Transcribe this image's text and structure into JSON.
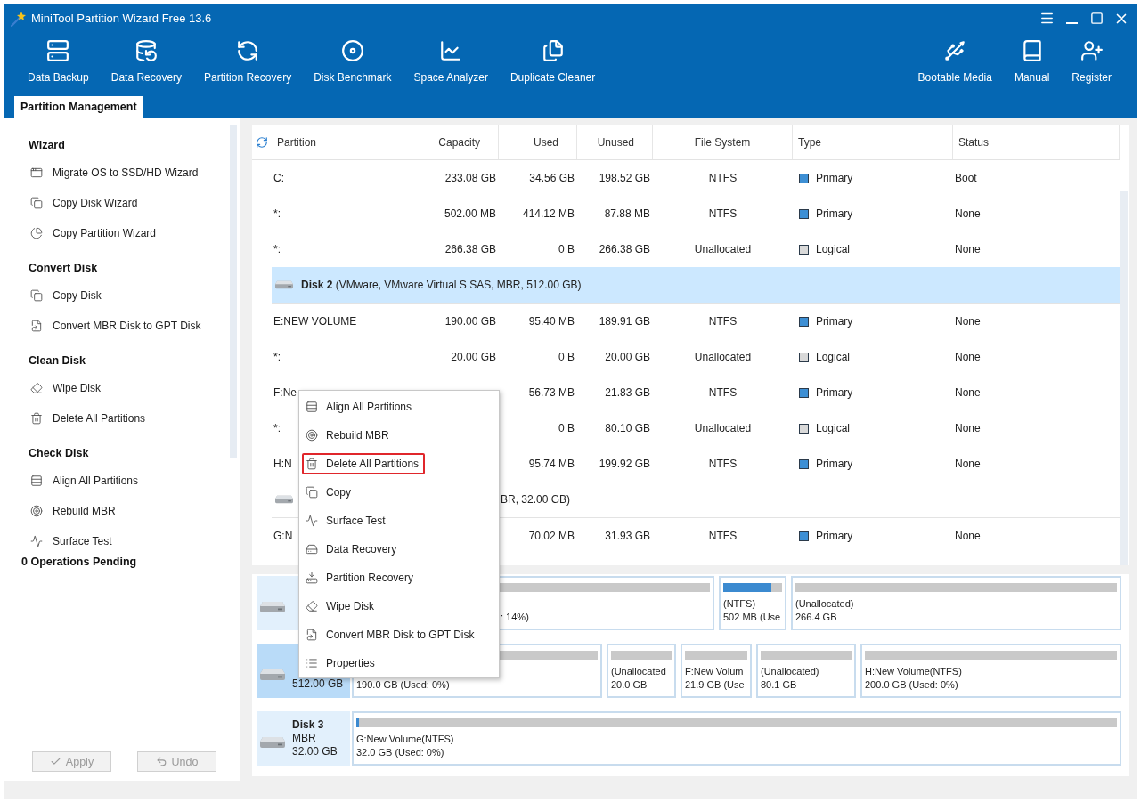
{
  "window": {
    "title": "MiniTool Partition Wizard Free 13.6"
  },
  "toolbar": {
    "left": [
      {
        "label": "Data Backup"
      },
      {
        "label": "Data Recovery"
      },
      {
        "label": "Partition Recovery"
      },
      {
        "label": "Disk Benchmark"
      },
      {
        "label": "Space Analyzer"
      },
      {
        "label": "Duplicate Cleaner"
      }
    ],
    "right": [
      {
        "label": "Bootable Media"
      },
      {
        "label": "Manual"
      },
      {
        "label": "Register"
      }
    ]
  },
  "tabs": [
    {
      "label": "Partition Management",
      "selected": true
    }
  ],
  "sidebar": {
    "sections": [
      {
        "heading": "Wizard",
        "items": [
          {
            "label": "Migrate OS to SSD/HD Wizard"
          },
          {
            "label": "Copy Disk Wizard"
          },
          {
            "label": "Copy Partition Wizard"
          }
        ]
      },
      {
        "heading": "Convert Disk",
        "items": [
          {
            "label": "Copy Disk"
          },
          {
            "label": "Convert MBR Disk to GPT Disk"
          }
        ]
      },
      {
        "heading": "Clean Disk",
        "items": [
          {
            "label": "Wipe Disk"
          },
          {
            "label": "Delete All Partitions"
          }
        ]
      },
      {
        "heading": "Check Disk",
        "items": [
          {
            "label": "Align All Partitions"
          },
          {
            "label": "Rebuild MBR"
          },
          {
            "label": "Surface Test"
          }
        ]
      }
    ],
    "pending": "0 Operations Pending",
    "buttons": [
      {
        "label": "Apply",
        "disabled": true
      },
      {
        "label": "Undo",
        "disabled": true
      }
    ]
  },
  "partition_table": {
    "columns": [
      "Partition",
      "Capacity",
      "Used",
      "Unused",
      "File System",
      "Type",
      "Status"
    ],
    "rows": [
      {
        "kind": "partition",
        "partition": "C:",
        "capacity": "233.08 GB",
        "used": "34.56 GB",
        "unused": "198.52 GB",
        "file_system": "NTFS",
        "type": "Primary",
        "color": "#3d8fd4",
        "status": "Boot"
      },
      {
        "kind": "partition",
        "partition": "*:",
        "capacity": "502.00 MB",
        "used": "414.12 MB",
        "unused": "87.88 MB",
        "file_system": "NTFS",
        "type": "Primary",
        "color": "#3d8fd4",
        "status": "None"
      },
      {
        "kind": "partition",
        "partition": "*:",
        "capacity": "266.38 GB",
        "used": "0 B",
        "unused": "266.38 GB",
        "file_system": "Unallocated",
        "type": "Logical",
        "color": "#d9d9d9",
        "status": "None"
      },
      {
        "kind": "disk",
        "title": "**Disk 2** (VMware, VMware Virtual S SAS, MBR, 512.00 GB)",
        "selected": true
      },
      {
        "kind": "partition",
        "partition": "E:NEW VOLUME",
        "capacity": "190.00 GB",
        "used": "95.40 MB",
        "unused": "189.91 GB",
        "file_system": "NTFS",
        "type": "Primary",
        "color": "#3d8fd4",
        "status": "None"
      },
      {
        "kind": "partition",
        "partition": "*:",
        "capacity": "20.00 GB",
        "used": "0 B",
        "unused": "20.00 GB",
        "file_system": "Unallocated",
        "type": "Logical",
        "color": "#d9d9d9",
        "status": "None"
      },
      {
        "kind": "partition",
        "partition": "F:Ne",
        "used": "56.73 MB",
        "unused": "21.83 GB",
        "file_system": "NTFS",
        "type": "Primary",
        "color": "#3d8fd4",
        "status": "None"
      },
      {
        "kind": "partition",
        "partition": "*:",
        "used": "0 B",
        "unused": "80.10 GB",
        "file_system": "Unallocated",
        "type": "Logical",
        "color": "#d9d9d9",
        "status": "None"
      },
      {
        "kind": "partition",
        "partition": "H:N",
        "used": "95.74 MB",
        "unused": "199.92 GB",
        "file_system": "NTFS",
        "type": "Primary",
        "color": "#3d8fd4",
        "status": "None"
      },
      {
        "kind": "disk",
        "title_tail": "BR, 32.00 GB)",
        "selected": false
      },
      {
        "kind": "partition",
        "partition": "G:N",
        "used": "70.02 MB",
        "unused": "31.93 GB",
        "file_system": "NTFS",
        "type": "Primary",
        "color": "#3d8fd4",
        "status": "None"
      }
    ]
  },
  "context_menu": {
    "items": [
      {
        "label": "Align All Partitions",
        "highlighted": false
      },
      {
        "label": "Rebuild MBR",
        "highlighted": false
      },
      {
        "label": "Delete All Partitions",
        "highlighted": true
      },
      {
        "label": "Copy",
        "highlighted": false
      },
      {
        "label": "Surface Test",
        "highlighted": false
      },
      {
        "label": "Data Recovery",
        "highlighted": false
      },
      {
        "label": "Partition Recovery",
        "highlighted": false
      },
      {
        "label": "Wipe Disk",
        "highlighted": false
      },
      {
        "label": "Convert MBR Disk to GPT Disk",
        "highlighted": false
      },
      {
        "label": "Properties",
        "highlighted": false
      }
    ]
  },
  "disk_map": {
    "disks": [
      {
        "selected": false,
        "partitions": [
          {
            "detail_tail": ": 14%)"
          },
          {
            "name": "(NTFS)",
            "detail": "502 MB (Use",
            "level": 0.82
          },
          {
            "name": "(Unallocated)",
            "detail": "266.4 GB"
          }
        ]
      },
      {
        "selected": true,
        "size": "512.00 GB",
        "partitions": [
          {
            "detail": "190.0 GB (Used: 0%)"
          },
          {
            "name": "(Unallocated",
            "detail": "20.0 GB"
          },
          {
            "name": "F:New Volum",
            "detail": "21.9 GB (Use"
          },
          {
            "name": "(Unallocated)",
            "detail": "80.1 GB"
          },
          {
            "name": "H:New Volume(NTFS)",
            "detail": "200.0 GB (Used: 0%)"
          }
        ]
      },
      {
        "selected": false,
        "name": "Disk 3",
        "scheme": "MBR",
        "size": "32.00 GB",
        "partitions": [
          {
            "name": "G:New Volume(NTFS)",
            "detail": "32.0 GB (Used: 0%)",
            "level": 0.004
          }
        ]
      }
    ]
  }
}
